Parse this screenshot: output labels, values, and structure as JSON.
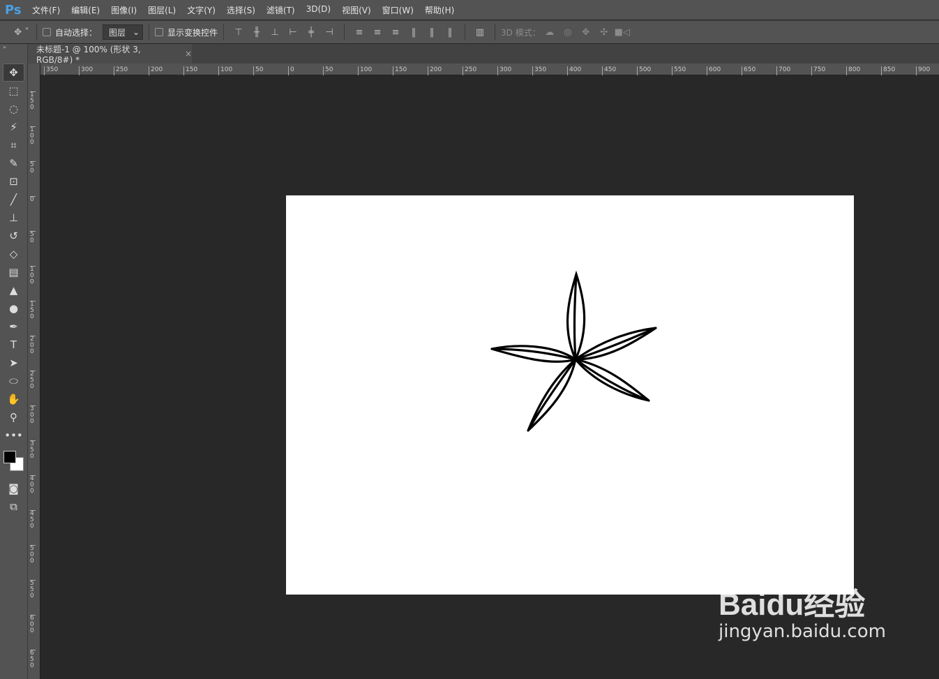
{
  "app": {
    "logo": "Ps"
  },
  "menu": [
    "文件(F)",
    "编辑(E)",
    "图像(I)",
    "图层(L)",
    "文字(Y)",
    "选择(S)",
    "滤镜(T)",
    "3D(D)",
    "视图(V)",
    "窗口(W)",
    "帮助(H)"
  ],
  "options": {
    "auto_select": "自动选择：",
    "layer_select": "图层",
    "show_transform": "显示变换控件",
    "mode_3d": "3D 模式："
  },
  "document_tab": {
    "title": "未标题-1 @ 100% (形状 3, RGB/8#) *",
    "close": "×"
  },
  "ruler_h": [
    "350",
    "300",
    "250",
    "200",
    "150",
    "100",
    "50",
    "0",
    "50",
    "100",
    "150",
    "200",
    "250",
    "300",
    "350",
    "400",
    "450",
    "500",
    "550",
    "600",
    "650",
    "700",
    "750",
    "800",
    "850",
    "900"
  ],
  "ruler_v": [
    "150",
    "100",
    "50",
    "0",
    "50",
    "100",
    "150",
    "200",
    "250",
    "300",
    "350",
    "400",
    "450",
    "500",
    "550",
    "600",
    "650"
  ],
  "tools": [
    "move",
    "marquee",
    "lasso",
    "magic-wand",
    "crop",
    "eyedropper",
    "patch",
    "brush",
    "stamp",
    "history-brush",
    "eraser",
    "gradient",
    "blur",
    "dodge",
    "pen",
    "type",
    "path-select",
    "ellipse",
    "hand",
    "zoom",
    "more"
  ],
  "colors": {
    "foreground": "#000000",
    "background": "#ffffff",
    "accent": "#4aa0e6"
  },
  "watermark": {
    "brand": "Baidu经验",
    "url": "jingyan.baidu.com"
  }
}
